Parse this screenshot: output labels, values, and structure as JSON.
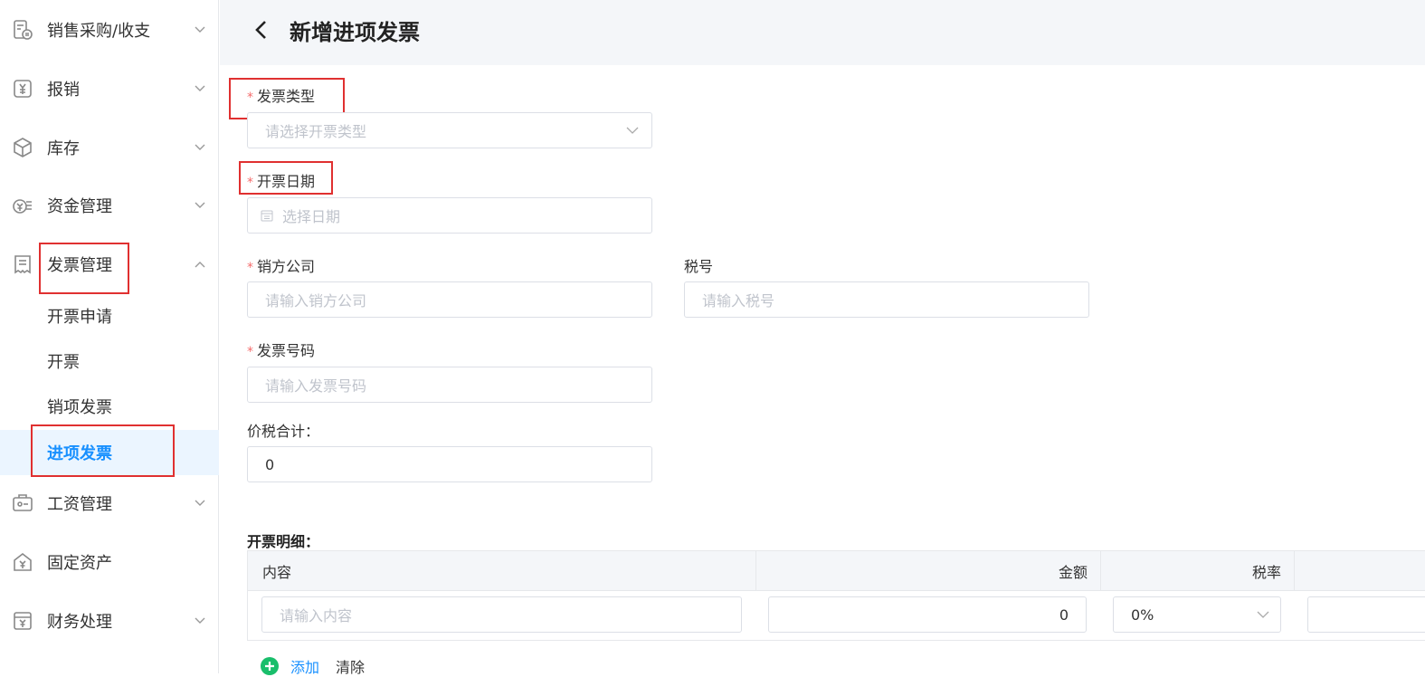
{
  "sidebar": {
    "items": [
      {
        "label": "销售采购/收支",
        "icon": "invoice-exchange-icon"
      },
      {
        "label": "报销",
        "icon": "yen-box-icon"
      },
      {
        "label": "库存",
        "icon": "cube-icon"
      },
      {
        "label": "资金管理",
        "icon": "money-icon"
      },
      {
        "label": "发票管理",
        "icon": "receipt-icon"
      },
      {
        "label": "工资管理",
        "icon": "salary-card-icon"
      },
      {
        "label": "固定资产",
        "icon": "house-yen-icon"
      },
      {
        "label": "财务处理",
        "icon": "ledger-icon"
      }
    ],
    "submenu": [
      "开票申请",
      "开票",
      "销项发票",
      "进项发票"
    ],
    "active_sub": "进项发票"
  },
  "header": {
    "title": "新增进项发票"
  },
  "form": {
    "invoice_type": {
      "label": "发票类型",
      "placeholder": "请选择开票类型"
    },
    "invoice_date": {
      "label": "开票日期",
      "placeholder": "选择日期"
    },
    "seller_company": {
      "label": "销方公司",
      "placeholder": "请输入销方公司"
    },
    "tax_id": {
      "label": "税号",
      "placeholder": "请输入税号"
    },
    "invoice_number": {
      "label": "发票号码",
      "placeholder": "请输入发票号码"
    },
    "total_with_tax": {
      "label": "价税合计：",
      "value": "0"
    }
  },
  "details": {
    "title": "开票明细：",
    "columns": [
      "内容",
      "金额",
      "税率"
    ],
    "row": {
      "content_placeholder": "请输入内容",
      "amount": "0",
      "tax_rate": "0%"
    },
    "add_label": "添加",
    "clear_label": "清除"
  },
  "colors": {
    "accent": "#1890ff",
    "required": "#f56c6c",
    "highlight_box": "#e03030",
    "add_green": "#19be6b"
  }
}
